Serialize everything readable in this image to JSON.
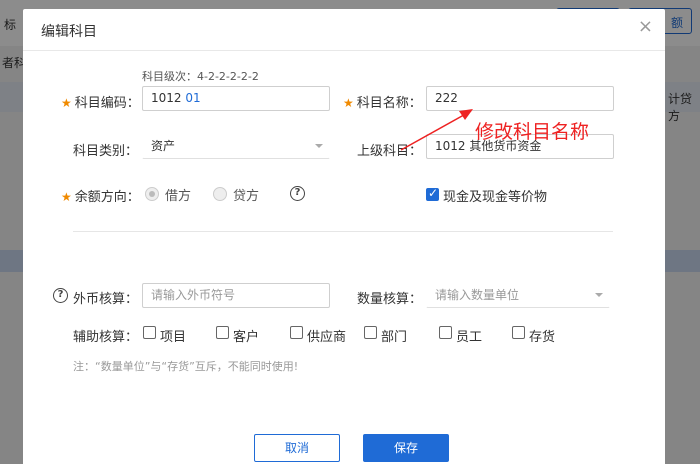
{
  "background": {
    "header_fragment": "标",
    "right_button_fragment": "额",
    "left_side_fragment": "者科目",
    "right_column_fragment": "计贷方"
  },
  "dialog": {
    "title": "编辑科目",
    "close_symbol": "×",
    "level_hint": "科目级次：4-2-2-2-2-2",
    "subject_code": {
      "label": "科目编码：",
      "prefix": "1012",
      "suffix": "01"
    },
    "subject_name": {
      "label": "科目名称：",
      "value": "222"
    },
    "subject_category": {
      "label": "科目类别：",
      "value": "资产"
    },
    "parent_subject": {
      "label": "上级科目：",
      "value": "1012 其他货币资金"
    },
    "balance_direction": {
      "label": "余额方向：",
      "debit": "借方",
      "credit": "贷方",
      "selected": "借方"
    },
    "cash_equivalent": {
      "label": "现金及现金等价物",
      "checked": true
    },
    "foreign_currency": {
      "label": "外币核算：",
      "placeholder": "请输入外币符号"
    },
    "quantity": {
      "label": "数量核算：",
      "placeholder": "请输入数量单位"
    },
    "auxiliary": {
      "label": "辅助核算：",
      "items": [
        "项目",
        "客户",
        "供应商",
        "部门",
        "员工",
        "存货"
      ]
    },
    "note": "注：“数量单位”与“存货”互斥，不能同时使用!",
    "cancel_label": "取消",
    "save_label": "保存"
  },
  "annotation": {
    "text": "修改科目名称",
    "color": "#ee2222"
  },
  "colors": {
    "primary": "#1f6bd6",
    "required_star": "#f08a00"
  }
}
